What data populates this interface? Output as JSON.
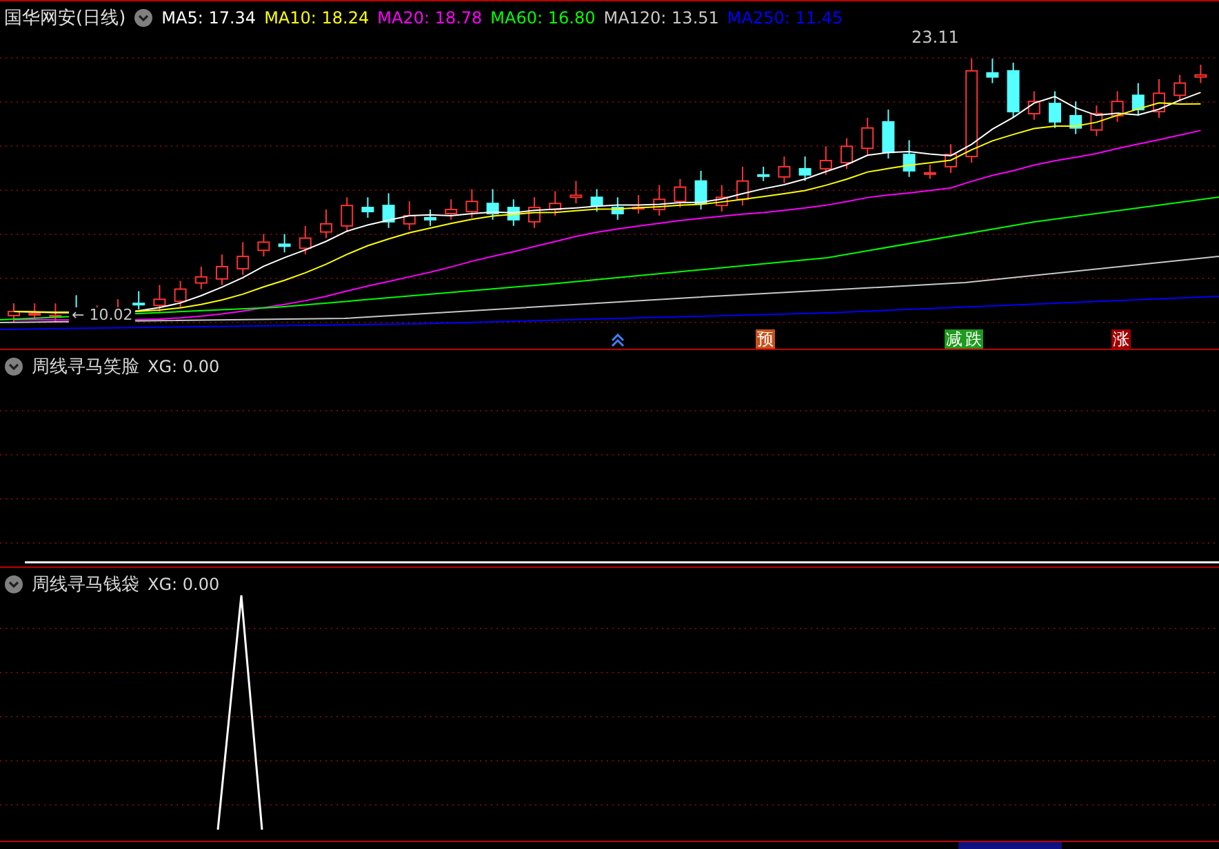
{
  "main_panel": {
    "title": "国华网安(日线)",
    "indicators": [
      {
        "label": "MA5: 17.34",
        "color": "#ffffff"
      },
      {
        "label": "MA10: 18.24",
        "color": "#ffff00"
      },
      {
        "label": "MA20: 18.78",
        "color": "#ff00ff"
      },
      {
        "label": "MA60: 16.80",
        "color": "#00ff00"
      },
      {
        "label": "MA120: 13.51",
        "color": "#c8c8c8"
      },
      {
        "label": "MA250: 11.45",
        "color": "#0000ff"
      }
    ],
    "high_label": "23.11",
    "low_label": "← 10.02",
    "signals": [
      {
        "kind": "arrow"
      },
      {
        "kind": "tag",
        "text": "预",
        "color": "#c8501a"
      },
      {
        "kind": "tag",
        "text": "减",
        "color": "#1e9a1e"
      },
      {
        "kind": "tag",
        "text": "跌",
        "color": "#1e9a1e"
      },
      {
        "kind": "tag",
        "text": "涨",
        "color": "#a00000"
      }
    ]
  },
  "indicator_panels": [
    {
      "title": "周线寻马笑脸",
      "value": "XG: 0.00",
      "spike": false
    },
    {
      "title": "周线寻马钱袋",
      "value": "XG: 0.00",
      "spike": true
    }
  ]
}
